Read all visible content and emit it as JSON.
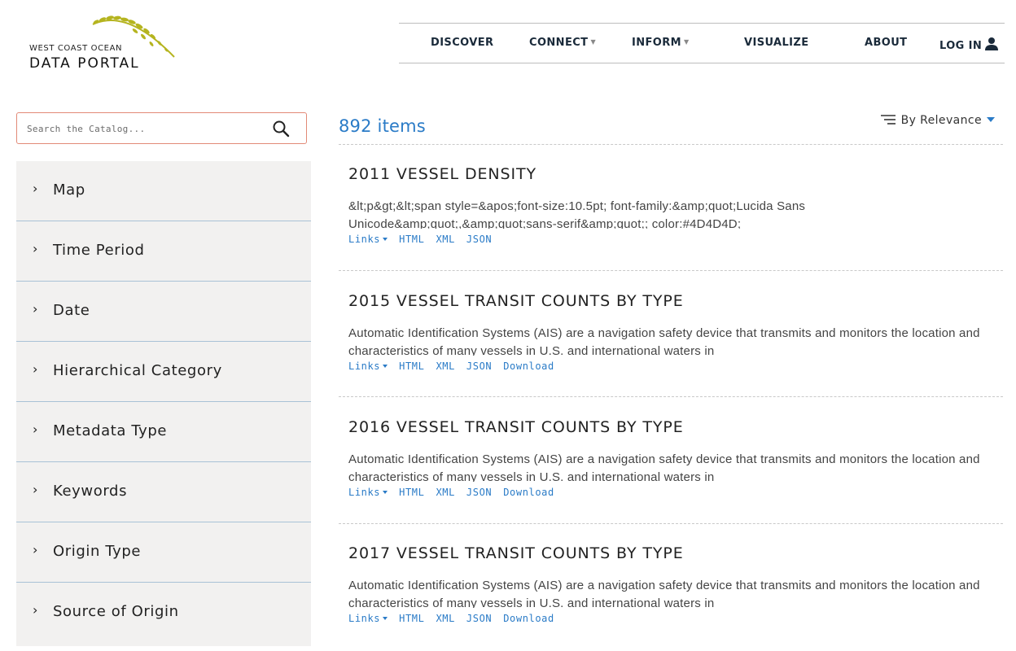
{
  "logo": {
    "line1": "WEST COAST OCEAN",
    "line2": "DATA PORTAL"
  },
  "nav": {
    "discover": "DISCOVER",
    "connect": "CONNECT",
    "inform": "INFORM",
    "visualize": "VISUALIZE",
    "about": "ABOUT",
    "login": "LOG IN"
  },
  "search": {
    "placeholder": "Search the Catalog..."
  },
  "facets": [
    {
      "label": "Map"
    },
    {
      "label": "Time Period"
    },
    {
      "label": "Date"
    },
    {
      "label": "Hierarchical Category"
    },
    {
      "label": "Metadata Type"
    },
    {
      "label": "Keywords"
    },
    {
      "label": "Origin Type"
    },
    {
      "label": "Source of Origin"
    }
  ],
  "results_header": {
    "count": "892 items",
    "sort_label": "By Relevance"
  },
  "links_labels": {
    "links": "Links",
    "html": "HTML",
    "xml": "XML",
    "json": "JSON",
    "download": "Download"
  },
  "results": [
    {
      "title": "2011 VESSEL DENSITY",
      "description": "&lt;p&gt;&lt;span style=&apos;font-size:10.5pt; font-family:&amp;quot;Lucida Sans Unicode&amp;quot;,&amp;quot;sans-serif&amp;quot;; color:#4D4D4D;"
    },
    {
      "title": "2015 VESSEL TRANSIT COUNTS BY TYPE",
      "description": "Automatic Identification Systems (AIS) are a navigation safety device that transmits and monitors the location and characteristics of many vessels in U.S. and international waters in"
    },
    {
      "title": "2016 VESSEL TRANSIT COUNTS BY TYPE",
      "description": "Automatic Identification Systems (AIS) are a navigation safety device that transmits and monitors the location and characteristics of many vessels in U.S. and international waters in"
    },
    {
      "title": "2017 VESSEL TRANSIT COUNTS BY TYPE",
      "description": "Automatic Identification Systems (AIS) are a navigation safety device that transmits and monitors the location and characteristics of many vessels in U.S. and international waters in"
    }
  ],
  "colors": {
    "accent": "#2a7bc7",
    "search_border": "#e28a77",
    "sidebar_bg": "#f2f1f0",
    "facet_divider": "#a9c2d6",
    "logo_leaf": "#b5b41f"
  },
  "icons": {
    "search": "search-icon",
    "user": "user-icon",
    "sort": "sort-icon",
    "chevron": "chevron-right-icon"
  }
}
